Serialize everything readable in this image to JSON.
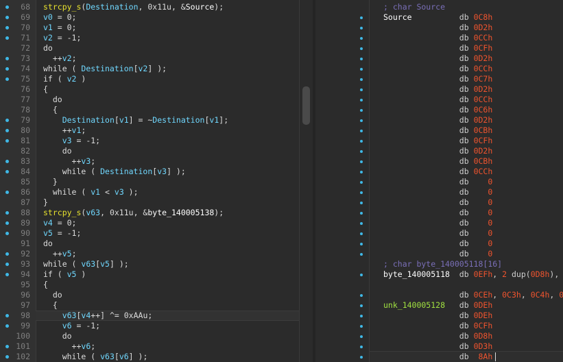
{
  "pseudocode": {
    "lines": [
      {
        "n": "68",
        "dot": true,
        "parts": [
          [
            "fn",
            "strcpy_s"
          ],
          [
            "kw",
            "("
          ],
          [
            "var",
            "Destination"
          ],
          [
            "kw",
            ", 0x11u, &"
          ],
          [
            "gl",
            "Source"
          ],
          [
            "kw",
            ");"
          ]
        ]
      },
      {
        "n": "69",
        "dot": true,
        "parts": [
          [
            "var",
            "v0"
          ],
          [
            "kw",
            " = 0;"
          ]
        ]
      },
      {
        "n": "70",
        "dot": true,
        "parts": [
          [
            "var",
            "v1"
          ],
          [
            "kw",
            " = 0;"
          ]
        ]
      },
      {
        "n": "71",
        "dot": true,
        "parts": [
          [
            "var",
            "v2"
          ],
          [
            "kw",
            " = -1;"
          ]
        ]
      },
      {
        "n": "72",
        "dot": false,
        "parts": [
          [
            "kw",
            "do"
          ]
        ]
      },
      {
        "n": "73",
        "dot": true,
        "parts": [
          [
            "kw",
            "  ++"
          ],
          [
            "var",
            "v2"
          ],
          [
            "kw",
            ";"
          ]
        ]
      },
      {
        "n": "74",
        "dot": true,
        "parts": [
          [
            "kw",
            "while ( "
          ],
          [
            "var",
            "Destination"
          ],
          [
            "kw",
            "["
          ],
          [
            "var",
            "v2"
          ],
          [
            "kw",
            "] );"
          ]
        ]
      },
      {
        "n": "75",
        "dot": true,
        "parts": [
          [
            "kw",
            "if ( "
          ],
          [
            "var",
            "v2"
          ],
          [
            "kw",
            " )"
          ]
        ]
      },
      {
        "n": "76",
        "dot": false,
        "parts": [
          [
            "kw",
            "{"
          ]
        ]
      },
      {
        "n": "77",
        "dot": false,
        "parts": [
          [
            "kw",
            "  do"
          ]
        ]
      },
      {
        "n": "78",
        "dot": false,
        "parts": [
          [
            "kw",
            "  {"
          ]
        ]
      },
      {
        "n": "79",
        "dot": true,
        "parts": [
          [
            "kw",
            "    "
          ],
          [
            "var",
            "Destination"
          ],
          [
            "kw",
            "["
          ],
          [
            "var",
            "v1"
          ],
          [
            "kw",
            "] = ~"
          ],
          [
            "var",
            "Destination"
          ],
          [
            "kw",
            "["
          ],
          [
            "var",
            "v1"
          ],
          [
            "kw",
            "];"
          ]
        ]
      },
      {
        "n": "80",
        "dot": true,
        "parts": [
          [
            "kw",
            "    ++"
          ],
          [
            "var",
            "v1"
          ],
          [
            "kw",
            ";"
          ]
        ]
      },
      {
        "n": "81",
        "dot": true,
        "parts": [
          [
            "kw",
            "    "
          ],
          [
            "var",
            "v3"
          ],
          [
            "kw",
            " = -1;"
          ]
        ]
      },
      {
        "n": "82",
        "dot": false,
        "parts": [
          [
            "kw",
            "    do"
          ]
        ]
      },
      {
        "n": "83",
        "dot": true,
        "parts": [
          [
            "kw",
            "      ++"
          ],
          [
            "var",
            "v3"
          ],
          [
            "kw",
            ";"
          ]
        ]
      },
      {
        "n": "84",
        "dot": true,
        "parts": [
          [
            "kw",
            "    while ( "
          ],
          [
            "var",
            "Destination"
          ],
          [
            "kw",
            "["
          ],
          [
            "var",
            "v3"
          ],
          [
            "kw",
            "] );"
          ]
        ]
      },
      {
        "n": "85",
        "dot": false,
        "parts": [
          [
            "kw",
            "  }"
          ]
        ]
      },
      {
        "n": "86",
        "dot": true,
        "parts": [
          [
            "kw",
            "  while ( "
          ],
          [
            "var",
            "v1"
          ],
          [
            "kw",
            " < "
          ],
          [
            "var",
            "v3"
          ],
          [
            "kw",
            " );"
          ]
        ]
      },
      {
        "n": "87",
        "dot": false,
        "parts": [
          [
            "kw",
            "}"
          ]
        ]
      },
      {
        "n": "88",
        "dot": true,
        "parts": [
          [
            "fn",
            "strcpy_s"
          ],
          [
            "kw",
            "("
          ],
          [
            "var",
            "v63"
          ],
          [
            "kw",
            ", 0x11u, &"
          ],
          [
            "gl",
            "byte_140005138"
          ],
          [
            "kw",
            ");"
          ]
        ]
      },
      {
        "n": "89",
        "dot": true,
        "parts": [
          [
            "var",
            "v4"
          ],
          [
            "kw",
            " = 0;"
          ]
        ]
      },
      {
        "n": "90",
        "dot": true,
        "parts": [
          [
            "var",
            "v5"
          ],
          [
            "kw",
            " = -1;"
          ]
        ]
      },
      {
        "n": "91",
        "dot": false,
        "parts": [
          [
            "kw",
            "do"
          ]
        ]
      },
      {
        "n": "92",
        "dot": true,
        "parts": [
          [
            "kw",
            "  ++"
          ],
          [
            "var",
            "v5"
          ],
          [
            "kw",
            ";"
          ]
        ]
      },
      {
        "n": "93",
        "dot": true,
        "parts": [
          [
            "kw",
            "while ( "
          ],
          [
            "var",
            "v63"
          ],
          [
            "kw",
            "["
          ],
          [
            "var",
            "v5"
          ],
          [
            "kw",
            "] );"
          ]
        ]
      },
      {
        "n": "94",
        "dot": true,
        "parts": [
          [
            "kw",
            "if ( "
          ],
          [
            "var",
            "v5"
          ],
          [
            "kw",
            " )"
          ]
        ]
      },
      {
        "n": "95",
        "dot": false,
        "parts": [
          [
            "kw",
            "{"
          ]
        ]
      },
      {
        "n": "96",
        "dot": false,
        "parts": [
          [
            "kw",
            "  do"
          ]
        ]
      },
      {
        "n": "97",
        "dot": false,
        "parts": [
          [
            "kw",
            "  {"
          ]
        ]
      },
      {
        "n": "98",
        "dot": true,
        "hl": true,
        "parts": [
          [
            "kw",
            "    "
          ],
          [
            "var",
            "v63"
          ],
          [
            "kw",
            "["
          ],
          [
            "var",
            "v4"
          ],
          [
            "kw",
            "++] ^= 0xAAu;"
          ]
        ]
      },
      {
        "n": "99",
        "dot": true,
        "parts": [
          [
            "kw",
            "    "
          ],
          [
            "var",
            "v6"
          ],
          [
            "kw",
            " = -1;"
          ]
        ]
      },
      {
        "n": "100",
        "dot": false,
        "parts": [
          [
            "kw",
            "    do"
          ]
        ]
      },
      {
        "n": "101",
        "dot": true,
        "parts": [
          [
            "kw",
            "      ++"
          ],
          [
            "var",
            "v6"
          ],
          [
            "kw",
            ";"
          ]
        ]
      },
      {
        "n": "102",
        "dot": true,
        "parts": [
          [
            "kw",
            "    while ( "
          ],
          [
            "var",
            "v63"
          ],
          [
            "kw",
            "["
          ],
          [
            "var",
            "v6"
          ],
          [
            "kw",
            "] );"
          ]
        ]
      }
    ]
  },
  "disasm": {
    "rows": [
      {
        "dot": false,
        "parts": [
          [
            "cmt",
            "; char Source"
          ]
        ]
      },
      {
        "dot": true,
        "parts": [
          [
            "lbl",
            "Source          "
          ],
          [
            "dir",
            "db "
          ],
          [
            "hex",
            "0C8h"
          ]
        ]
      },
      {
        "dot": true,
        "parts": [
          [
            "dir",
            "                db "
          ],
          [
            "hex",
            "0D2h"
          ]
        ]
      },
      {
        "dot": true,
        "parts": [
          [
            "dir",
            "                db "
          ],
          [
            "hex",
            "0CCh"
          ]
        ]
      },
      {
        "dot": true,
        "parts": [
          [
            "dir",
            "                db "
          ],
          [
            "hex",
            "0CFh"
          ]
        ]
      },
      {
        "dot": true,
        "parts": [
          [
            "dir",
            "                db "
          ],
          [
            "hex",
            "0D2h"
          ]
        ]
      },
      {
        "dot": true,
        "parts": [
          [
            "dir",
            "                db "
          ],
          [
            "hex",
            "0CCh"
          ]
        ]
      },
      {
        "dot": true,
        "parts": [
          [
            "dir",
            "                db "
          ],
          [
            "hex",
            "0C7h"
          ]
        ]
      },
      {
        "dot": true,
        "parts": [
          [
            "dir",
            "                db "
          ],
          [
            "hex",
            "0D2h"
          ]
        ]
      },
      {
        "dot": true,
        "parts": [
          [
            "dir",
            "                db "
          ],
          [
            "hex",
            "0CCh"
          ]
        ]
      },
      {
        "dot": true,
        "parts": [
          [
            "dir",
            "                db "
          ],
          [
            "hex",
            "0C6h"
          ]
        ]
      },
      {
        "dot": true,
        "parts": [
          [
            "dir",
            "                db "
          ],
          [
            "hex",
            "0D2h"
          ]
        ]
      },
      {
        "dot": true,
        "parts": [
          [
            "dir",
            "                db "
          ],
          [
            "hex",
            "0CBh"
          ]
        ]
      },
      {
        "dot": true,
        "parts": [
          [
            "dir",
            "                db "
          ],
          [
            "hex",
            "0CFh"
          ]
        ]
      },
      {
        "dot": true,
        "parts": [
          [
            "dir",
            "                db "
          ],
          [
            "hex",
            "0D2h"
          ]
        ]
      },
      {
        "dot": true,
        "parts": [
          [
            "dir",
            "                db "
          ],
          [
            "hex",
            "0CBh"
          ]
        ]
      },
      {
        "dot": true,
        "parts": [
          [
            "dir",
            "                db "
          ],
          [
            "hex",
            "0CCh"
          ]
        ]
      },
      {
        "dot": true,
        "parts": [
          [
            "dir",
            "                db    "
          ],
          [
            "hex",
            "0"
          ]
        ]
      },
      {
        "dot": true,
        "parts": [
          [
            "dir",
            "                db    "
          ],
          [
            "hex",
            "0"
          ]
        ]
      },
      {
        "dot": true,
        "parts": [
          [
            "dir",
            "                db    "
          ],
          [
            "hex",
            "0"
          ]
        ]
      },
      {
        "dot": true,
        "parts": [
          [
            "dir",
            "                db    "
          ],
          [
            "hex",
            "0"
          ]
        ]
      },
      {
        "dot": true,
        "parts": [
          [
            "dir",
            "                db    "
          ],
          [
            "hex",
            "0"
          ]
        ]
      },
      {
        "dot": true,
        "parts": [
          [
            "dir",
            "                db    "
          ],
          [
            "hex",
            "0"
          ]
        ]
      },
      {
        "dot": true,
        "parts": [
          [
            "dir",
            "                db    "
          ],
          [
            "hex",
            "0"
          ]
        ]
      },
      {
        "dot": true,
        "parts": [
          [
            "dir",
            "                db    "
          ],
          [
            "hex",
            "0"
          ]
        ]
      },
      {
        "dot": false,
        "parts": [
          [
            "cmt",
            "; char byte_140005118[16]"
          ]
        ]
      },
      {
        "dot": true,
        "parts": [
          [
            "lbl",
            "byte_140005118  "
          ],
          [
            "dir",
            "db "
          ],
          [
            "hex",
            "0EFh"
          ],
          [
            "dir",
            ", "
          ],
          [
            "hex",
            "2"
          ],
          [
            "dir",
            " dup("
          ],
          [
            "hex",
            "0D8h"
          ],
          [
            "dir",
            "),"
          ]
        ]
      },
      {
        "dot": false,
        "parts": [
          [
            "dir",
            " "
          ]
        ]
      },
      {
        "dot": true,
        "parts": [
          [
            "dir",
            "                db "
          ],
          [
            "hex",
            "0CEh"
          ],
          [
            "dir",
            ", "
          ],
          [
            "hex",
            "0C3h"
          ],
          [
            "dir",
            ", "
          ],
          [
            "hex",
            "0C4h"
          ],
          [
            "dir",
            ", "
          ],
          [
            "hex",
            "0"
          ]
        ]
      },
      {
        "dot": true,
        "parts": [
          [
            "lbl-yg",
            "unk_140005128   "
          ],
          [
            "dir",
            "db "
          ],
          [
            "hex",
            "0DEh"
          ]
        ]
      },
      {
        "dot": true,
        "parts": [
          [
            "dir",
            "                db "
          ],
          [
            "hex",
            "0DEh"
          ]
        ]
      },
      {
        "dot": true,
        "parts": [
          [
            "dir",
            "                db "
          ],
          [
            "hex",
            "0CFh"
          ]
        ]
      },
      {
        "dot": true,
        "parts": [
          [
            "dir",
            "                db "
          ],
          [
            "hex",
            "0D8h"
          ]
        ]
      },
      {
        "dot": true,
        "parts": [
          [
            "dir",
            "                db "
          ],
          [
            "hex",
            "0D3h"
          ]
        ]
      },
      {
        "dot": true,
        "cursor": true,
        "parts": [
          [
            "dir",
            "                db  "
          ],
          [
            "hex",
            "8Ah"
          ]
        ]
      }
    ]
  }
}
